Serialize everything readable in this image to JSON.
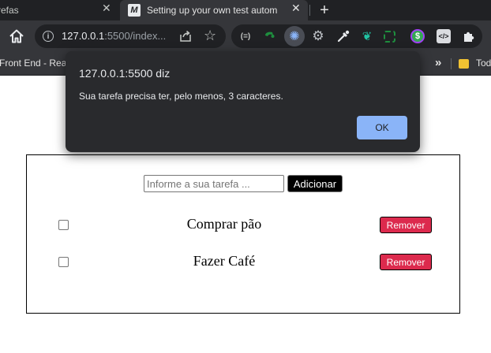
{
  "browser": {
    "tabs": [
      {
        "label": "refas"
      },
      {
        "label": "Setting up your own test autom",
        "favicon": "M"
      }
    ],
    "address": {
      "host": "127.0.0.1",
      "path": ":5500/index..."
    },
    "bookmarks": [
      "Front End - React",
      "Tod"
    ],
    "extension_icons": [
      "usb-icon",
      "fire-icon",
      "settings-ext-icon",
      "gear-icon",
      "eyedropper-icon",
      "bird-icon",
      "screenshot-icon",
      "dollar-icon",
      "code-icon",
      "puzzle-icon"
    ]
  },
  "alert": {
    "title": "127.0.0.1:5500 diz",
    "message": "Sua tarefa precisa ter, pelo menos, 3 caracteres.",
    "ok_label": "OK"
  },
  "todo": {
    "input_placeholder": "Informe a sua tarefa ...",
    "add_label": "Adicionar",
    "tasks": [
      {
        "text": "Comprar pão",
        "remove_label": "Remover",
        "done": false
      },
      {
        "text": "Fazer Café",
        "remove_label": "Remover",
        "done": false
      }
    ]
  },
  "colors": {
    "chrome_dark": "#202124",
    "toolbar": "#35363a",
    "dialog_bg": "#292a2d",
    "dialog_button": "#8ab4f8",
    "remove_button": "#dc2a4d"
  }
}
